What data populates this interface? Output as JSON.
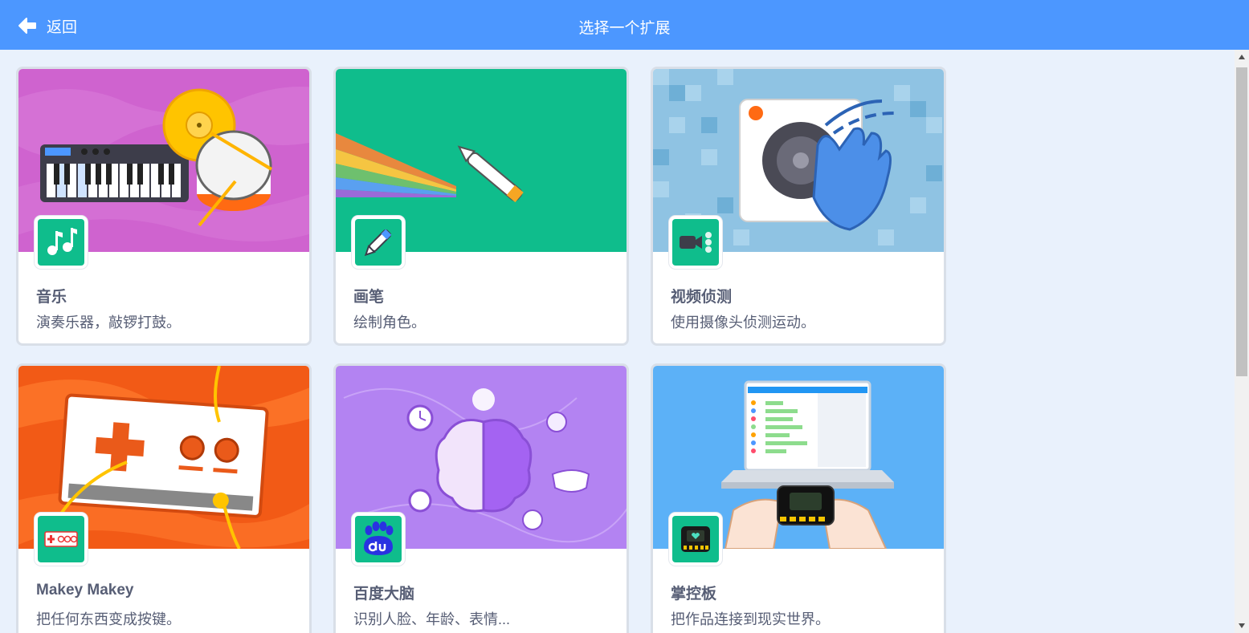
{
  "header": {
    "back_label": "返回",
    "title": "选择一个扩展"
  },
  "colors": {
    "header": "#4c97ff",
    "background": "#e9f1fc",
    "icon_green": "#0fbd8c",
    "text": "#575e75"
  },
  "extensions": [
    {
      "name": "音乐",
      "description": "演奏乐器，敲锣打鼓。",
      "icon": "music-notes-icon"
    },
    {
      "name": "画笔",
      "description": "绘制角色。",
      "icon": "pen-icon"
    },
    {
      "name": "视频侦测",
      "description": "使用摄像头侦测运动。",
      "icon": "video-camera-icon"
    },
    {
      "name": "Makey Makey",
      "description": "把任何东西变成按键。",
      "icon": "makey-makey-icon"
    },
    {
      "name": "百度大脑",
      "description": "识别人脸、年龄、表情...",
      "icon": "baidu-du-icon"
    },
    {
      "name": "掌控板",
      "description": "把作品连接到现实世界。",
      "icon": "controller-board-icon"
    }
  ]
}
